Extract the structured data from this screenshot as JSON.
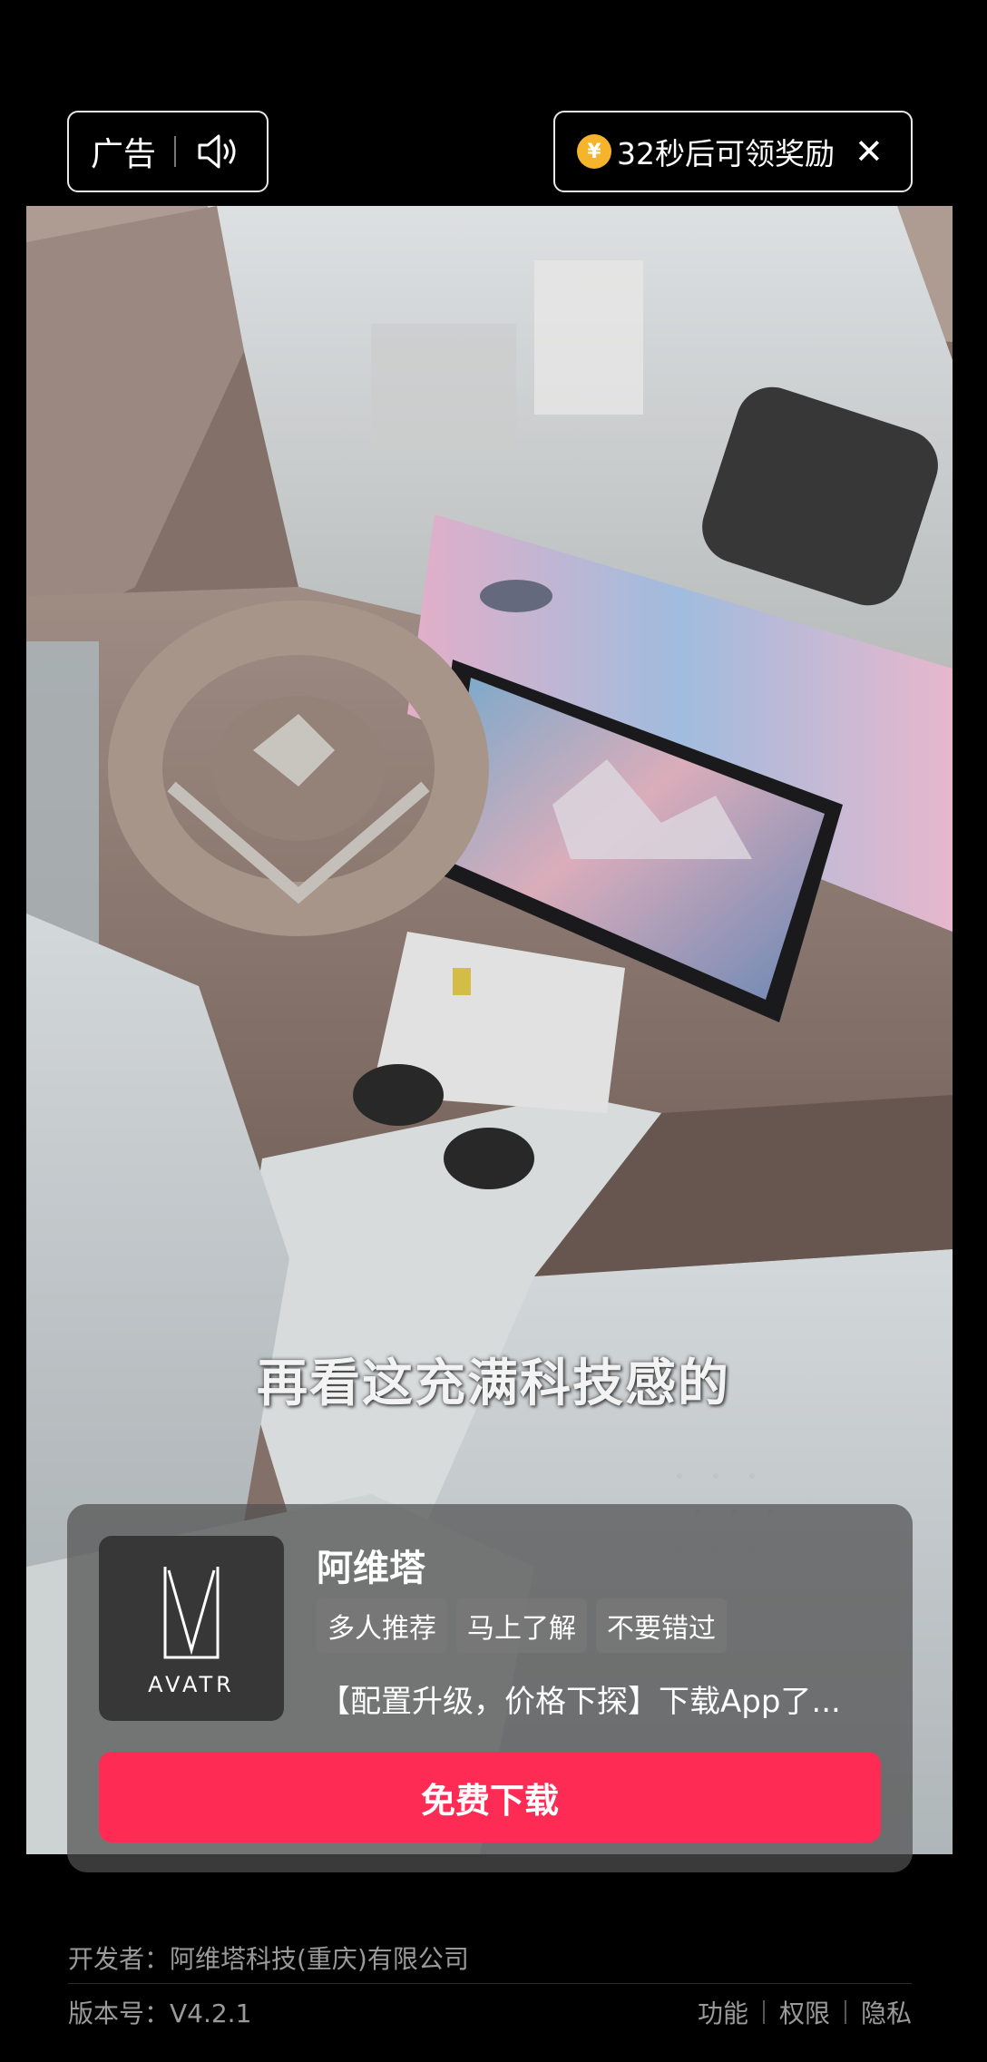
{
  "top_bar": {
    "ad_label": "广告",
    "reward_coin_symbol": "¥",
    "reward_text": "32秒后可领奖励",
    "close_glyph": "✕",
    "sound_icon": "speaker-icon",
    "close_icon": "close-icon"
  },
  "video": {
    "subtitle": "再看这充满科技感的"
  },
  "ad_card": {
    "app_name": "阿维塔",
    "logo_text": "AVATR",
    "tags": [
      "多人推荐",
      "马上了解",
      "不要错过"
    ],
    "description": "【配置升级，价格下探】下载App了...",
    "button_label": "免费下载"
  },
  "footer": {
    "developer": "开发者：阿维塔科技(重庆)有限公司",
    "version": "版本号：V4.2.1",
    "links": [
      "功能",
      "权限",
      "隐私"
    ]
  },
  "colors": {
    "button": "#fe2c55",
    "coin": "#f6b32c",
    "background": "#000000"
  }
}
